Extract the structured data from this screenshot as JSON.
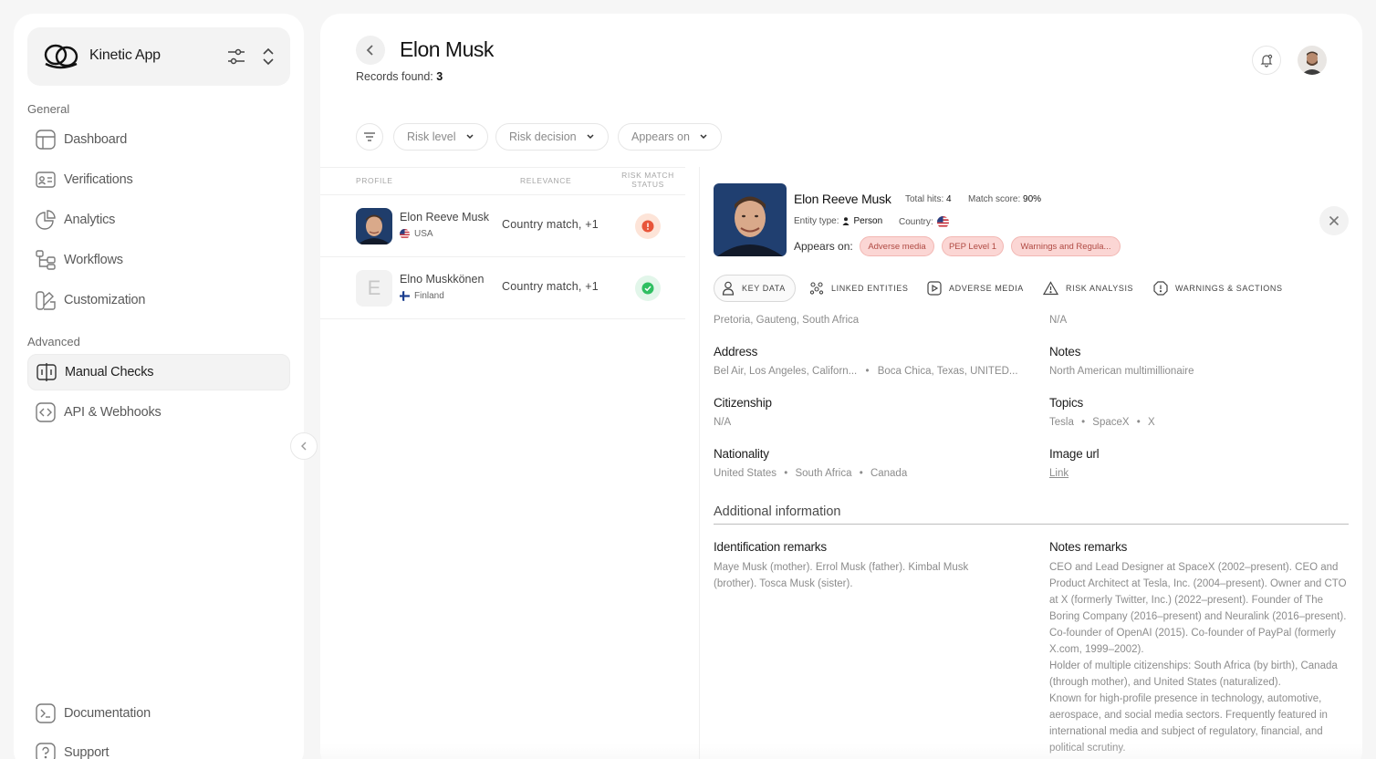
{
  "app": {
    "name": "Kinetic App"
  },
  "sidebar": {
    "general_label": "General",
    "advanced_label": "Advanced",
    "general_items": [
      {
        "label": "Dashboard",
        "icon": "dashboard-icon"
      },
      {
        "label": "Verifications",
        "icon": "id-card-icon"
      },
      {
        "label": "Analytics",
        "icon": "pie-chart-icon"
      },
      {
        "label": "Workflows",
        "icon": "workflow-icon"
      },
      {
        "label": "Customization",
        "icon": "brush-icon"
      }
    ],
    "advanced_items": [
      {
        "label": "Manual Checks",
        "icon": "manual-check-icon",
        "active": true
      },
      {
        "label": "API & Webhooks",
        "icon": "code-icon"
      }
    ],
    "bottom_items": [
      {
        "label": "Documentation",
        "icon": "terminal-icon"
      },
      {
        "label": "Support",
        "icon": "help-icon"
      }
    ]
  },
  "header": {
    "title": "Elon Musk",
    "records_label": "Records found:",
    "records_count": "3"
  },
  "filters": [
    {
      "label": "Risk level"
    },
    {
      "label": "Risk decision"
    },
    {
      "label": "Appears on"
    }
  ],
  "results": {
    "columns": {
      "profile": "PROFILE",
      "relevance": "RELEVANCE",
      "status_line1": "RISK MATCH",
      "status_line2": "STATUS"
    },
    "rows": [
      {
        "name": "Elon Reeve Musk",
        "country": "USA",
        "relevance": "Country match, +1",
        "status": "risk"
      },
      {
        "name": "Elno Muskkönen",
        "country": "Finland",
        "relevance": "Country match, +1",
        "status": "clear",
        "initial": "E"
      }
    ]
  },
  "detail": {
    "name": "Elon Reeve Musk",
    "total_hits_label": "Total hits:",
    "total_hits": "4",
    "match_score_label": "Match score:",
    "match_score": "90%",
    "entity_type_label": "Entity type:",
    "entity_type": "Person",
    "country_label": "Country:",
    "appears_on_label": "Appears on:",
    "tags": [
      "Adverse media",
      "PEP Level 1",
      "Warnings and Regula..."
    ],
    "tabs": [
      "KEY DATA",
      "LINKED ENTITIES",
      "ADVERSE MEDIA",
      "RISK ANALYSIS",
      "WARNINGS & SACTIONS"
    ],
    "partial_left": "Pretoria, Gauteng, South Africa",
    "partial_right": "N/A",
    "fields": {
      "address_label": "Address",
      "address_1": "Bel Air, Los Angeles, Californ...",
      "address_2": "Boca Chica, Texas, UNITED...",
      "notes_label": "Notes",
      "notes_value": "North American multimillionaire",
      "citizenship_label": "Citizenship",
      "citizenship_value": "N/A",
      "topics_label": "Topics",
      "topics": [
        "Tesla",
        "SpaceX",
        "X"
      ],
      "nationality_label": "Nationality",
      "nationalities": [
        "United States",
        "South Africa",
        "Canada"
      ],
      "image_url_label": "Image url",
      "image_url_value": "Link"
    },
    "additional_title": "Additional information",
    "identification_label": "Identification remarks",
    "identification_text": "Maye Musk (mother). Errol Musk (father). Kimbal Musk (brother). Tosca Musk (sister).",
    "notes_remarks_label": "Notes remarks",
    "notes_remarks_p1": "CEO and Lead Designer at SpaceX (2002–present). CEO and Product Architect at Tesla, Inc. (2004–present). Owner and CTO at X (formerly Twitter, Inc.) (2022–present). Founder of The Boring Company (2016–present) and Neuralink (2016–present). Co-founder of OpenAI (2015). Co-founder of PayPal (formerly X.com, 1999–2002).",
    "notes_remarks_p2": "Holder of multiple citizenships: South Africa (by birth), Canada (through mother), and United States (naturalized).",
    "notes_remarks_p3": "Known for high-profile presence in technology, automotive, aerospace, and social media sectors. Frequently featured in international media and subject of regulatory, financial, and political scrutiny."
  },
  "colors": {
    "risk": "#e8553a",
    "clear": "#2fbf62",
    "tag_bg": "#fbd6d4"
  }
}
